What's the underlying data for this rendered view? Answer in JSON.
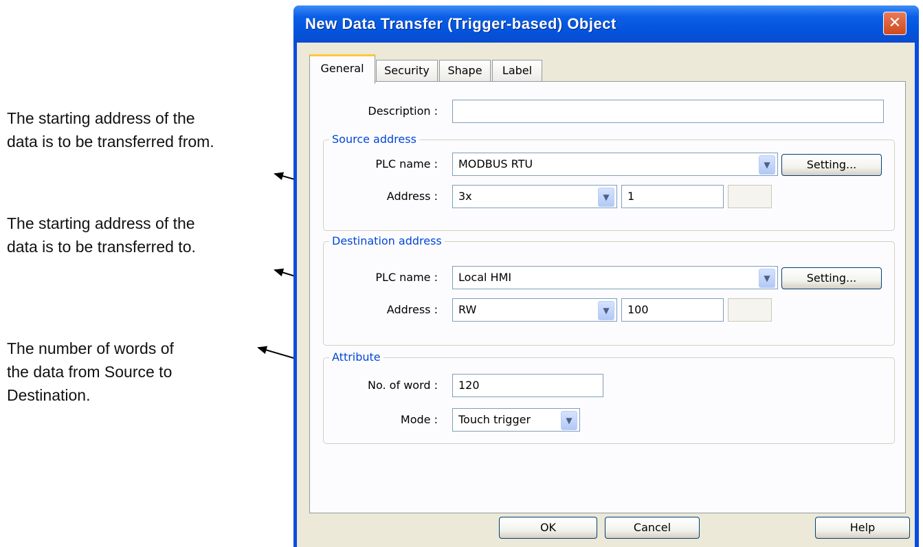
{
  "annotations": {
    "source": [
      "The starting address of the",
      "data is to be transferred from."
    ],
    "destination": [
      "The starting address of the",
      "data is to be transferred to."
    ],
    "words": [
      "The number of words of",
      "the data from Source to",
      "Destination."
    ]
  },
  "dialog": {
    "title": "New  Data Transfer (Trigger-based) Object",
    "close_glyph": "✕",
    "tabs": [
      "General",
      "Security",
      "Shape",
      "Label"
    ],
    "active_tab": "General",
    "description": {
      "label": "Description :",
      "value": ""
    },
    "source": {
      "legend": "Source address",
      "plc_label": "PLC name :",
      "plc_value": "MODBUS RTU",
      "setting_label": "Setting...",
      "address_label": "Address :",
      "address_type": "3x",
      "address_value": "1"
    },
    "destination": {
      "legend": "Destination address",
      "plc_label": "PLC name :",
      "plc_value": "Local HMI",
      "setting_label": "Setting...",
      "address_label": "Address :",
      "address_type": "RW",
      "address_value": "100"
    },
    "attribute": {
      "legend": "Attribute",
      "words_label": "No. of word :",
      "words_value": "120",
      "mode_label": "Mode :",
      "mode_value": "Touch trigger"
    },
    "buttons": {
      "ok": "OK",
      "cancel": "Cancel",
      "help": "Help"
    },
    "dropdown_glyph": "▼"
  }
}
